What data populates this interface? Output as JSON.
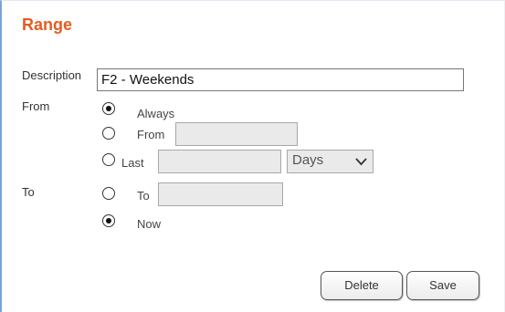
{
  "panel": {
    "title": "Range"
  },
  "description": {
    "label": "Description",
    "value": "F2 - Weekends"
  },
  "from": {
    "label": "From",
    "options": [
      {
        "label": "Always",
        "selected": true
      },
      {
        "label": "From",
        "selected": false
      },
      {
        "label": "Last",
        "selected": false
      }
    ],
    "unit_select": {
      "value": "Days"
    }
  },
  "to": {
    "label": "To",
    "options": [
      {
        "label": "To",
        "selected": false
      },
      {
        "label": "Now",
        "selected": true
      }
    ]
  },
  "buttons": {
    "delete": "Delete",
    "save": "Save"
  }
}
